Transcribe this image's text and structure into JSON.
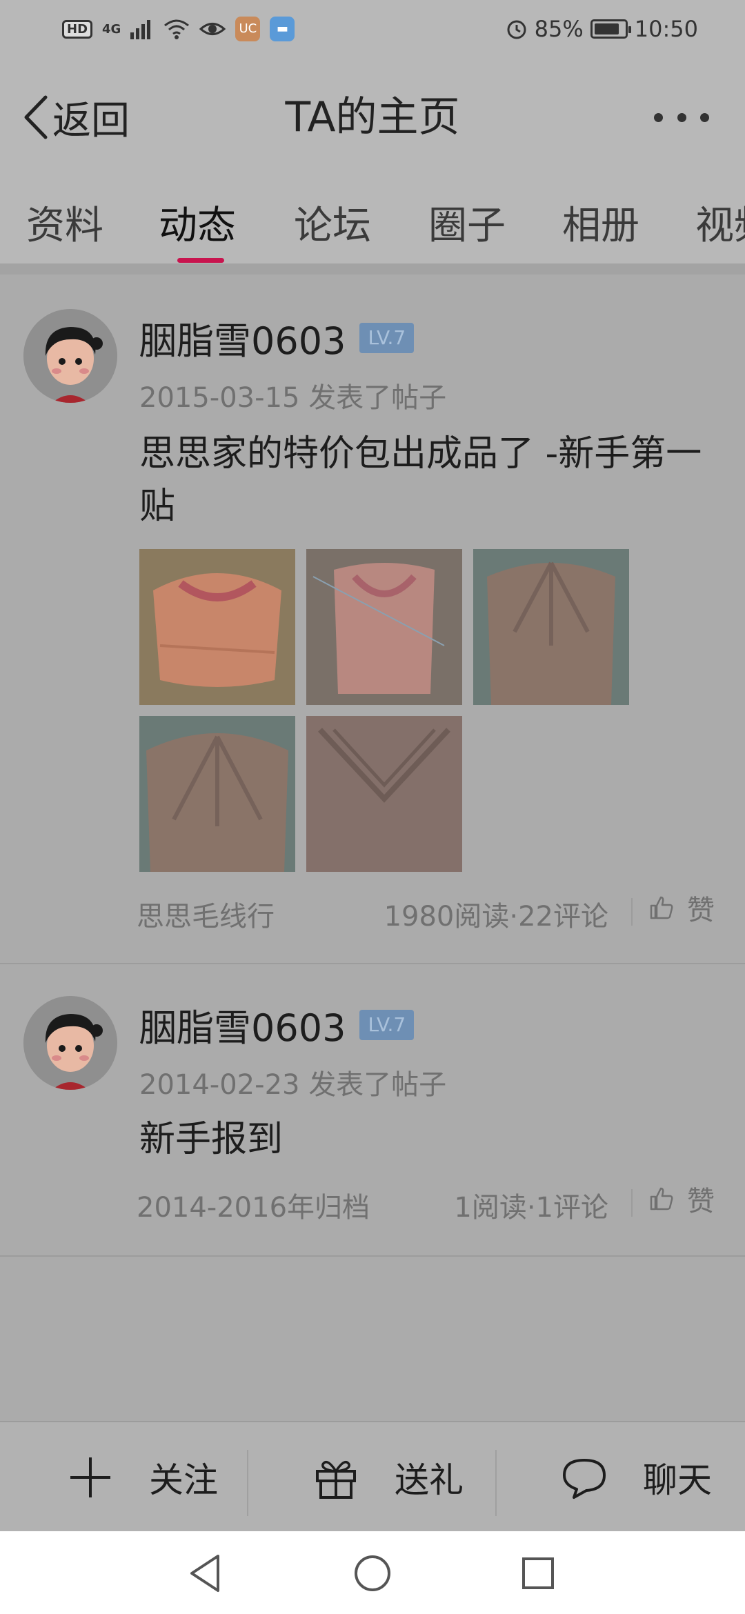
{
  "status_bar": {
    "hd": "HD",
    "network": "4G",
    "app_icon_1": "UC",
    "battery": "85%",
    "battery_level": 0.85,
    "time": "10:50"
  },
  "nav": {
    "back_label": "返回",
    "title": "TA的主页",
    "more_icon": "more-dots-icon"
  },
  "tabs": [
    {
      "label": "资料",
      "active": false
    },
    {
      "label": "动态",
      "active": true
    },
    {
      "label": "论坛",
      "active": false
    },
    {
      "label": "圈子",
      "active": false
    },
    {
      "label": "相册",
      "active": false
    },
    {
      "label": "视频",
      "active": false
    }
  ],
  "posts": [
    {
      "username": "胭脂雪0603",
      "level": "LV.7",
      "date": "2015-03-15",
      "action": "发表了帖子",
      "title": "思思家的特价包出成品了 -新手第一贴",
      "images": 5,
      "source": "思思毛线行",
      "stats": "1980阅读·22评论",
      "like_label": "赞"
    },
    {
      "username": "胭脂雪0603",
      "level": "LV.7",
      "date": "2014-02-23",
      "action": "发表了帖子",
      "title": "新手报到",
      "images": 0,
      "source": "2014-2016年归档",
      "stats": "1阅读·1评论",
      "like_label": "赞"
    }
  ],
  "actions": {
    "follow": "关注",
    "gift": "送礼",
    "chat": "聊天"
  },
  "colors": {
    "accent": "#c8144e",
    "level_badge": "#6e8fb4"
  }
}
